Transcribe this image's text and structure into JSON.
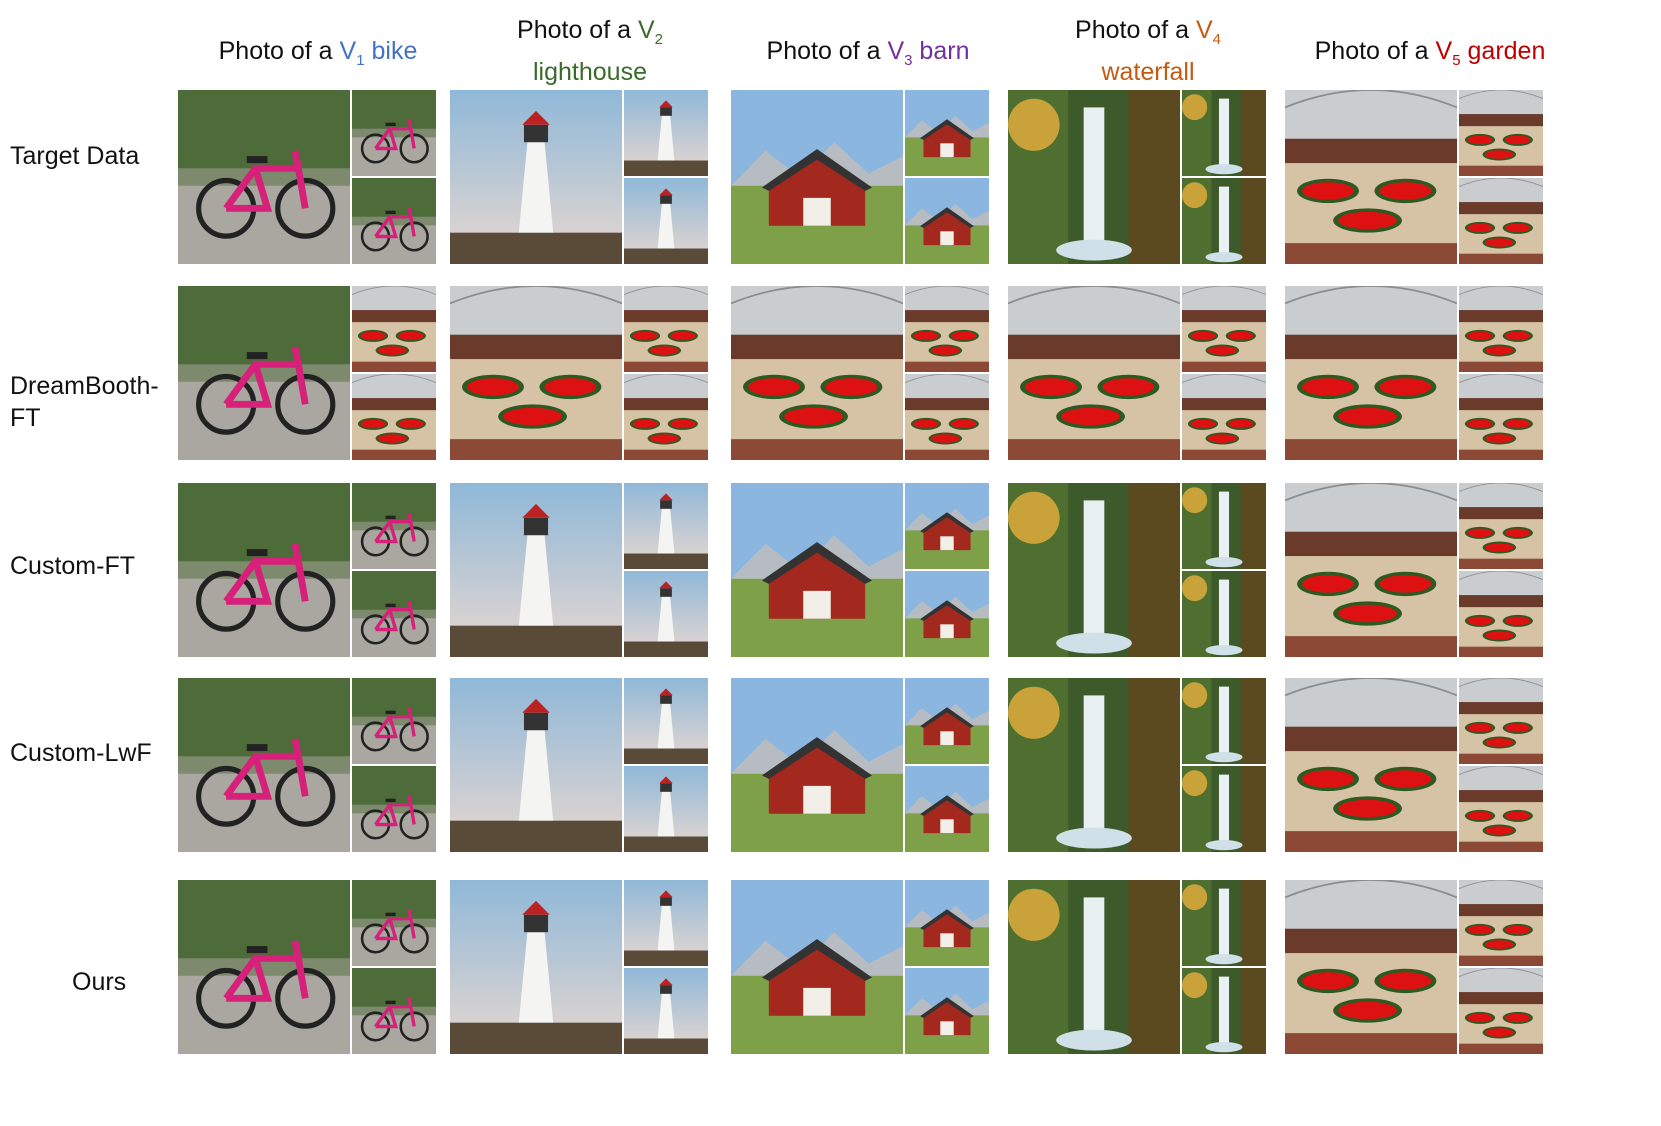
{
  "columns": [
    {
      "prefix": "Photo of a ",
      "token": "V",
      "sub": "1",
      "noun": " bike",
      "color": "#4472c4"
    },
    {
      "prefix": "Photo of a ",
      "token": "V",
      "sub": "2",
      "noun": "lighthouse",
      "color": "#3a6b2a"
    },
    {
      "prefix": "Photo of a ",
      "token": "V",
      "sub": "3",
      "noun": " barn",
      "color": "#7030a0"
    },
    {
      "prefix": "Photo of a ",
      "token": "V",
      "sub": "4",
      "noun": "waterfall",
      "color": "#c55a11"
    },
    {
      "prefix": "Photo of a ",
      "token": "V",
      "sub": "5",
      "noun": " garden",
      "color": "#c00000"
    }
  ],
  "rows": [
    {
      "label": "Target Data"
    },
    {
      "label": "DreamBooth-FT"
    },
    {
      "label": "Custom-FT"
    },
    {
      "label": "Custom-LwF"
    },
    {
      "label": "Ours"
    }
  ],
  "scene_types": [
    "bike",
    "lighthouse",
    "barn",
    "waterfall",
    "garden"
  ]
}
